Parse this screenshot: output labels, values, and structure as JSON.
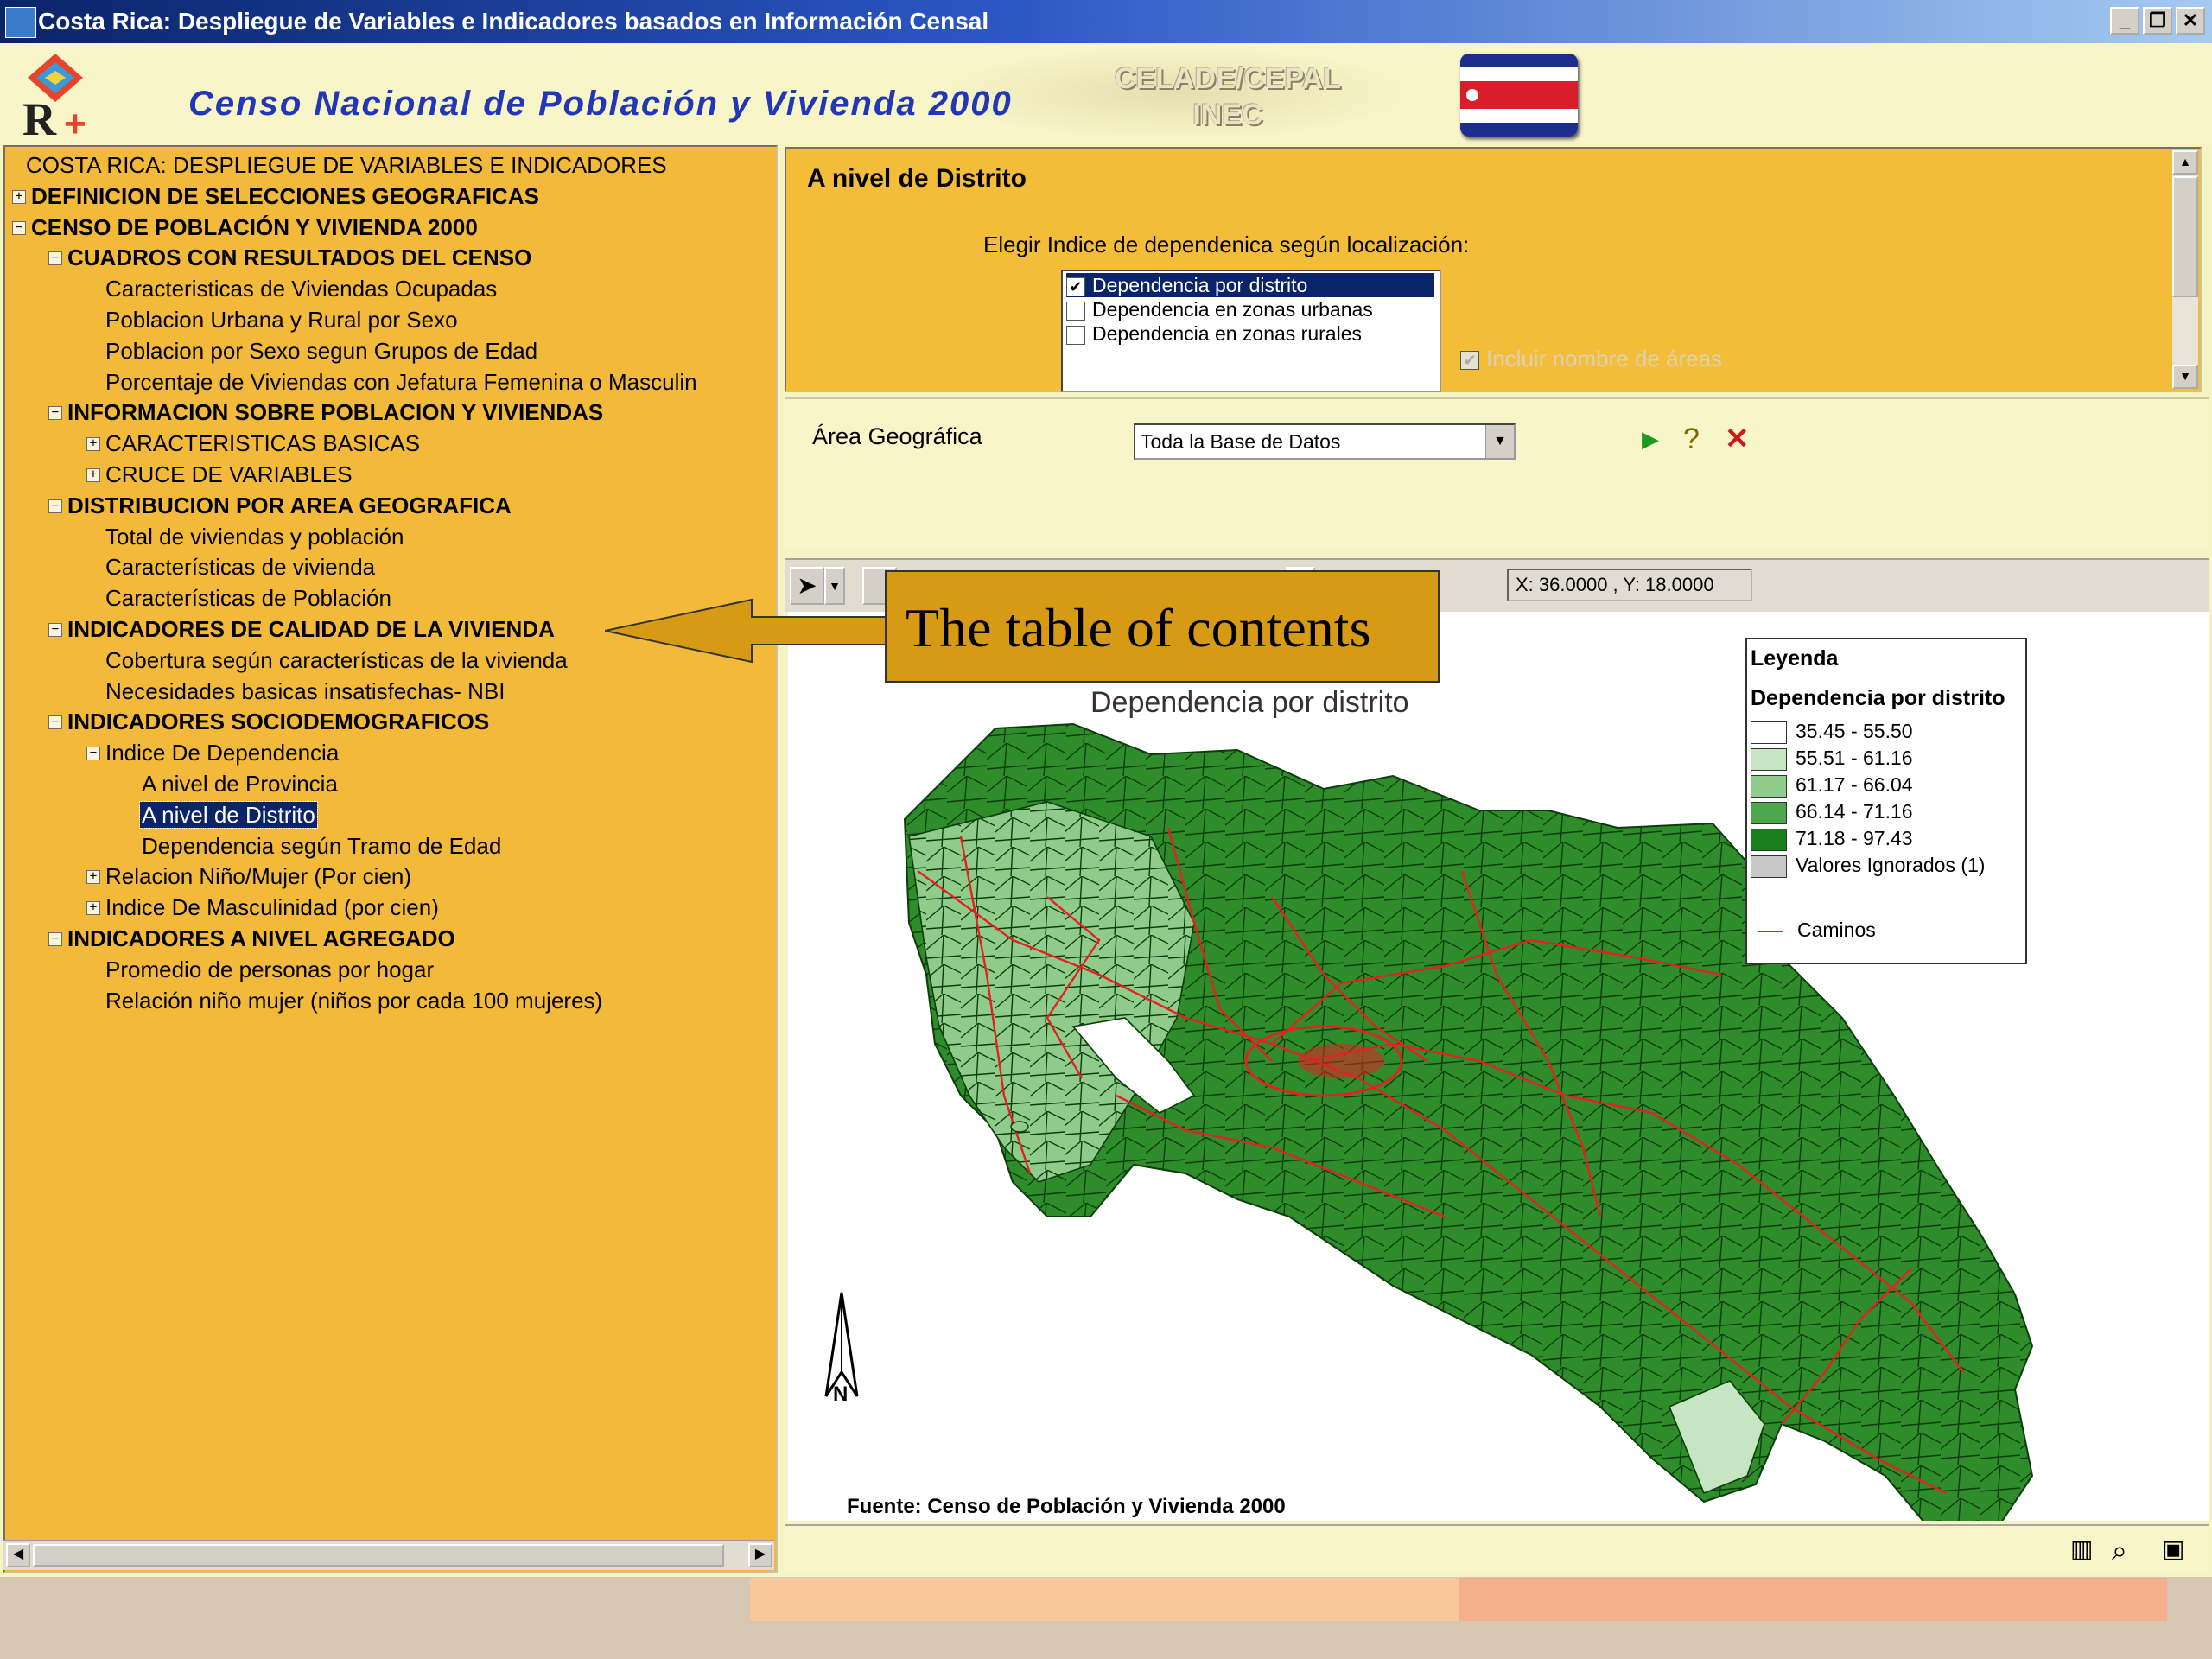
{
  "window": {
    "title": "Costa Rica: Despliegue de Variables e Indicadores basados en Información Censal",
    "buttons": [
      "_",
      "❐",
      "✕"
    ]
  },
  "header": {
    "census_title": "Censo Nacional de Población y Vivienda 2000",
    "org_line1": "CELADE/CEPAL",
    "org_line2": "INEC"
  },
  "tree": {
    "nodes": [
      {
        "label": "COSTA RICA: DESPLIEGUE DE VARIABLES E INDICADORES",
        "level": 0,
        "toggle": "−",
        "bold": false
      },
      {
        "label": "DEFINICION DE SELECCIONES GEOGRAFICAS",
        "level": 1,
        "toggle": "+",
        "bold": true
      },
      {
        "label": "CENSO DE POBLACIÓN Y VIVIENDA 2000",
        "level": 1,
        "toggle": "−",
        "bold": true
      },
      {
        "label": "CUADROS CON RESULTADOS DEL CENSO",
        "level": 2,
        "toggle": "−",
        "bold": true
      },
      {
        "label": "Caracteristicas de Viviendas Ocupadas",
        "level": 3,
        "toggle": "",
        "bold": false
      },
      {
        "label": "Poblacion Urbana y Rural por Sexo",
        "level": 3,
        "toggle": "",
        "bold": false
      },
      {
        "label": "Poblacion por Sexo segun Grupos de Edad",
        "level": 3,
        "toggle": "",
        "bold": false
      },
      {
        "label": "Porcentaje de Viviendas con Jefatura Femenina o Masculin",
        "level": 3,
        "toggle": "",
        "bold": false
      },
      {
        "label": "INFORMACION SOBRE POBLACION Y VIVIENDAS",
        "level": 2,
        "toggle": "−",
        "bold": true
      },
      {
        "label": "CARACTERISTICAS BASICAS",
        "level": 3,
        "toggle": "+",
        "bold": false
      },
      {
        "label": "CRUCE DE VARIABLES",
        "level": 3,
        "toggle": "+",
        "bold": false
      },
      {
        "label": "DISTRIBUCION POR AREA GEOGRAFICA",
        "level": 2,
        "toggle": "−",
        "bold": true
      },
      {
        "label": "Total de viviendas y población",
        "level": 3,
        "toggle": "",
        "bold": false
      },
      {
        "label": "Características de vivienda",
        "level": 3,
        "toggle": "",
        "bold": false
      },
      {
        "label": "Características de Población",
        "level": 3,
        "toggle": "",
        "bold": false
      },
      {
        "label": "INDICADORES DE CALIDAD DE LA VIVIENDA",
        "level": 2,
        "toggle": "−",
        "bold": true
      },
      {
        "label": "Cobertura según características de la vivienda",
        "level": 3,
        "toggle": "",
        "bold": false
      },
      {
        "label": "Necesidades basicas insatisfechas- NBI",
        "level": 3,
        "toggle": "",
        "bold": false
      },
      {
        "label": "INDICADORES SOCIODEMOGRAFICOS",
        "level": 2,
        "toggle": "−",
        "bold": true
      },
      {
        "label": "Indice De Dependencia",
        "level": 3,
        "toggle": "−",
        "bold": false
      },
      {
        "label": "A nivel de Provincia",
        "level": 4,
        "toggle": "",
        "bold": false
      },
      {
        "label": "A nivel de Distrito",
        "level": 4,
        "toggle": "",
        "bold": false,
        "selected": true
      },
      {
        "label": "Dependencia según Tramo de Edad",
        "level": 4,
        "toggle": "",
        "bold": false
      },
      {
        "label": "Relacion Niño/Mujer (Por cien)",
        "level": 3,
        "toggle": "+",
        "bold": false
      },
      {
        "label": "Indice De Masculinidad (por cien)",
        "level": 3,
        "toggle": "+",
        "bold": false
      },
      {
        "label": "INDICADORES A NIVEL AGREGADO",
        "level": 2,
        "toggle": "−",
        "bold": true
      },
      {
        "label": "Promedio de personas por hogar",
        "level": 3,
        "toggle": "",
        "bold": false
      },
      {
        "label": "Relación niño mujer (niños por cada 100 mujeres)",
        "level": 3,
        "toggle": "",
        "bold": false
      }
    ]
  },
  "options": {
    "title": "A nivel de Distrito",
    "prompt": "Elegir Indice de dependenica según localización:",
    "list_items": [
      {
        "label": "Dependencia por distrito",
        "checked": true,
        "selected": true
      },
      {
        "label": "Dependencia en zonas urbanas",
        "checked": false,
        "selected": false
      },
      {
        "label": "Dependencia en zonas rurales",
        "checked": false,
        "selected": false
      }
    ],
    "include_names_label": "Incluir nombre de áreas"
  },
  "area": {
    "label": "Área Geográfica",
    "combo_value": "Toda la Base de Datos"
  },
  "map": {
    "coord_readout": "X: 36.0000 , Y: 18.0000",
    "title": "Dependencia por distrito",
    "source": "Fuente: Censo de Población y Vivienda 2000",
    "north_label": "N",
    "legend": {
      "title": "Leyenda",
      "subtitle": "Dependencia por distrito",
      "classes": [
        {
          "label": "35.45 - 55.50",
          "color": "#ffffff"
        },
        {
          "label": "55.51 - 61.16",
          "color": "#c6e6c3"
        },
        {
          "label": "61.17 - 66.04",
          "color": "#8fcc8b"
        },
        {
          "label": "66.14 - 71.16",
          "color": "#4ea64c"
        },
        {
          "label": "71.18 - 97.43",
          "color": "#1a7f1a"
        },
        {
          "label": "Valores Ignorados (1)",
          "color": "#c8c8c8"
        }
      ],
      "roads_label": "Caminos"
    }
  },
  "annotation": {
    "text": "The table of contents"
  },
  "colors": {
    "tree_bg": "#f2b93a",
    "panel_bg": "#f8f5c8",
    "selection": "#0a246a",
    "road": "#e62020"
  }
}
